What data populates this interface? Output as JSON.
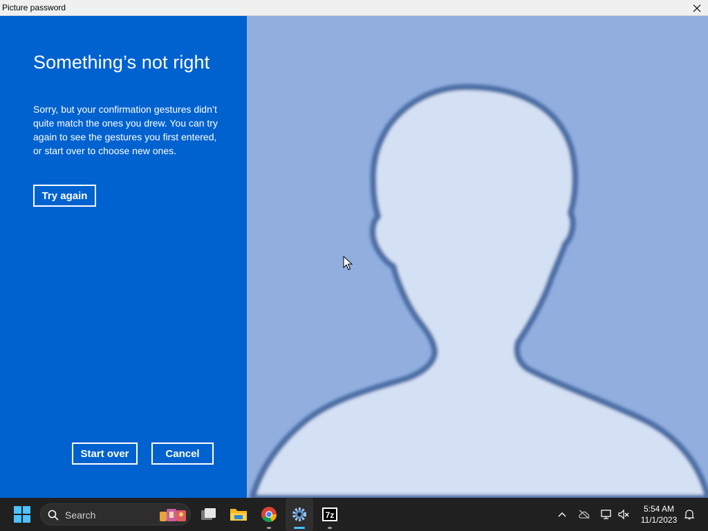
{
  "window": {
    "title": "Picture password"
  },
  "panel": {
    "heading": "Something’s not right",
    "message": "Sorry, but your confirmation gestures didn’t quite match the ones you drew. You can try again to see the gestures you first entered, or start over to choose new ones.",
    "try_again_label": "Try again",
    "start_over_label": "Start over",
    "cancel_label": "Cancel"
  },
  "taskbar": {
    "search_label": "Search",
    "apps": [
      "start-icon",
      "search-icon",
      "task-view-icon",
      "file-explorer-icon",
      "chrome-icon",
      "settings-icon",
      "7zip-icon"
    ],
    "tray": {
      "time": "5:54 AM",
      "date": "11/1/2023"
    }
  },
  "colors": {
    "panel_bg": "#0062cf",
    "picture_bg": "#91aedf",
    "silhouette_fill": "#d4e0f4",
    "silhouette_edge": "#4d6fa6",
    "taskbar_bg": "#202020"
  }
}
